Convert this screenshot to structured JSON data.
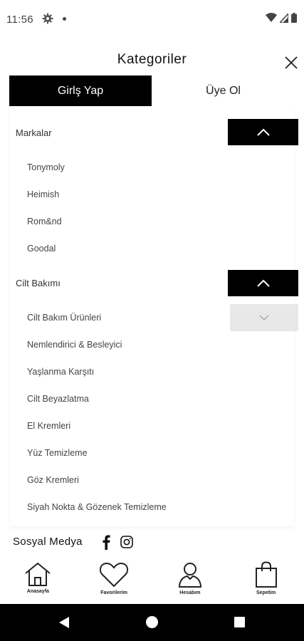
{
  "status": {
    "time": "11:56"
  },
  "header": {
    "title": "Kategoriler"
  },
  "auth": {
    "login_label": "Girlş Yap",
    "register_label": "Üye Ol"
  },
  "sections": [
    {
      "title": "Markalar",
      "items": [
        "Tonymoly",
        "Heimish",
        "Rom&nd",
        "Goodal"
      ]
    },
    {
      "title": "Cilt Bakımı",
      "items": [
        "Cilt Bakım Ürünleri",
        "Nemlendirici & Besleyici",
        "Yaşlanma Karşıtı",
        "Cilt Beyazlatma",
        "El Kremleri",
        "Yüz Temizleme",
        "Göz Kremleri",
        "Siyah Nokta & Gözenek Temizleme"
      ]
    }
  ],
  "social": {
    "label": "Sosyal Medya"
  },
  "bottom_nav": [
    {
      "label": "Anasayfa",
      "icon": "home-icon"
    },
    {
      "label": "Favorilerim",
      "icon": "heart-icon"
    },
    {
      "label": "Hesabım",
      "icon": "user-icon"
    },
    {
      "label": "Sepetim",
      "icon": "bag-icon"
    }
  ],
  "colors": {
    "accent": "#000000",
    "subtle_button": "#e8e8e8"
  }
}
